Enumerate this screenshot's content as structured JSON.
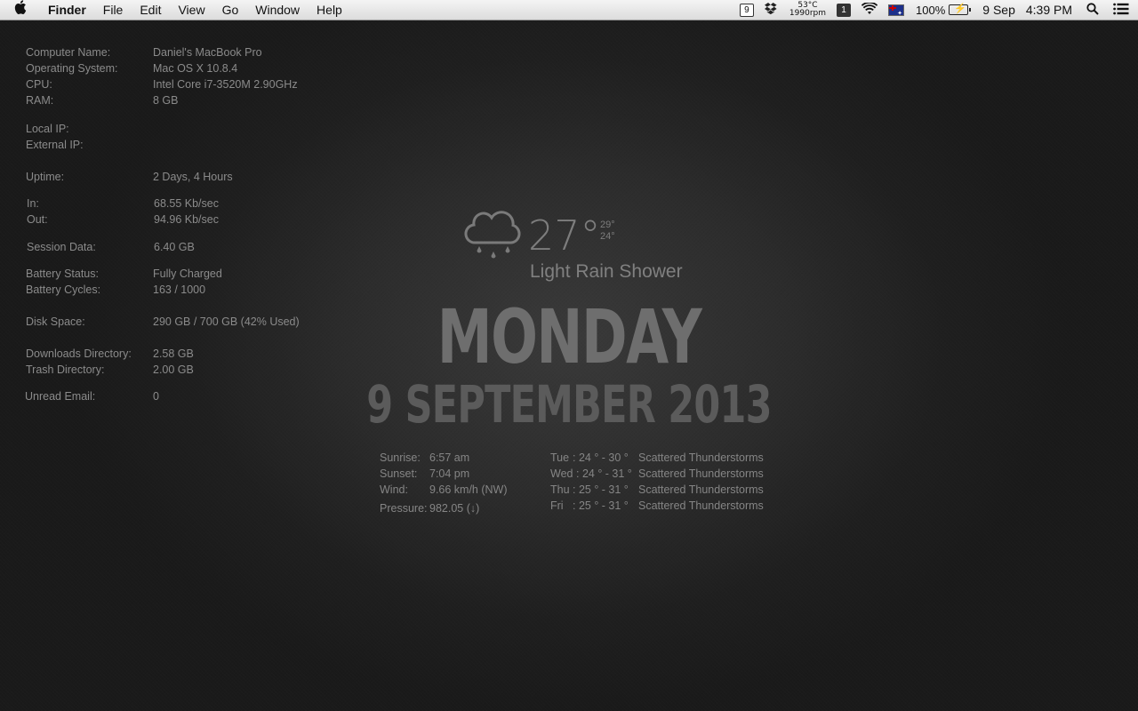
{
  "menubar": {
    "apple": "",
    "app_name": "Finder",
    "menus": [
      "File",
      "Edit",
      "View",
      "Go",
      "Window",
      "Help"
    ],
    "status": {
      "calendar_day": "9",
      "temp": "53°C",
      "fan": "1990rpm",
      "one_icon": "1",
      "battery_pct": "100%",
      "date": "9 Sep",
      "time": "4:39 PM"
    }
  },
  "system_info": [
    {
      "label": "Computer Name:",
      "value": "Daniel's MacBook Pro"
    },
    {
      "label": "Operating System:",
      "value": "Mac OS X 10.8.4"
    },
    {
      "label": "CPU:",
      "value": "Intel Core i7-3520M 2.90GHz"
    },
    {
      "label": "RAM:",
      "value": "8 GB"
    },
    {
      "label": "Local IP:",
      "value": ""
    },
    {
      "label": "External IP:",
      "value": ""
    },
    {
      "label": "Uptime:",
      "value": "2 Days, 4 Hours"
    },
    {
      "label": "In:",
      "value": "68.55 Kb/sec"
    },
    {
      "label": "Out:",
      "value": "94.96 Kb/sec"
    },
    {
      "label": "Session Data:",
      "value": "6.40 GB"
    },
    {
      "label": "Battery Status:",
      "value": "Fully Charged"
    },
    {
      "label": "Battery Cycles:",
      "value": "163 / 1000"
    },
    {
      "label": "Disk Space:",
      "value": "290 GB / 700 GB (42% Used)"
    },
    {
      "label": "Downloads Directory:",
      "value": "2.58 GB"
    },
    {
      "label": "Trash Directory:",
      "value": "2.00 GB"
    },
    {
      "label": "Unread Email:",
      "value": "0"
    }
  ],
  "weather": {
    "temperature": "27°",
    "high": "29°",
    "low": "24°",
    "condition": "Light Rain Shower",
    "day": "MONDAY",
    "date": "9 SEPTEMBER 2013",
    "details": [
      {
        "label": "Sunrise:",
        "value": "6:57 am"
      },
      {
        "label": "Sunset:",
        "value": "7:04 pm"
      },
      {
        "label": "Wind:",
        "value": "9.66 km/h (NW)"
      },
      {
        "label": "Pressure:",
        "value": "982.05 (↓)"
      }
    ],
    "forecast": [
      {
        "day": "Tue",
        "temps": ":  24 ° - 30 °",
        "condition": "Scattered Thunderstorms"
      },
      {
        "day": "Wed",
        "temps": ":  24 ° - 31 °",
        "condition": "Scattered Thunderstorms"
      },
      {
        "day": "Thu",
        "temps": ":  25 ° - 31 °",
        "condition": "Scattered Thunderstorms"
      },
      {
        "day": "Fri",
        "temps": ":  25 ° - 31 °",
        "condition": "Scattered Thunderstorms"
      }
    ]
  }
}
